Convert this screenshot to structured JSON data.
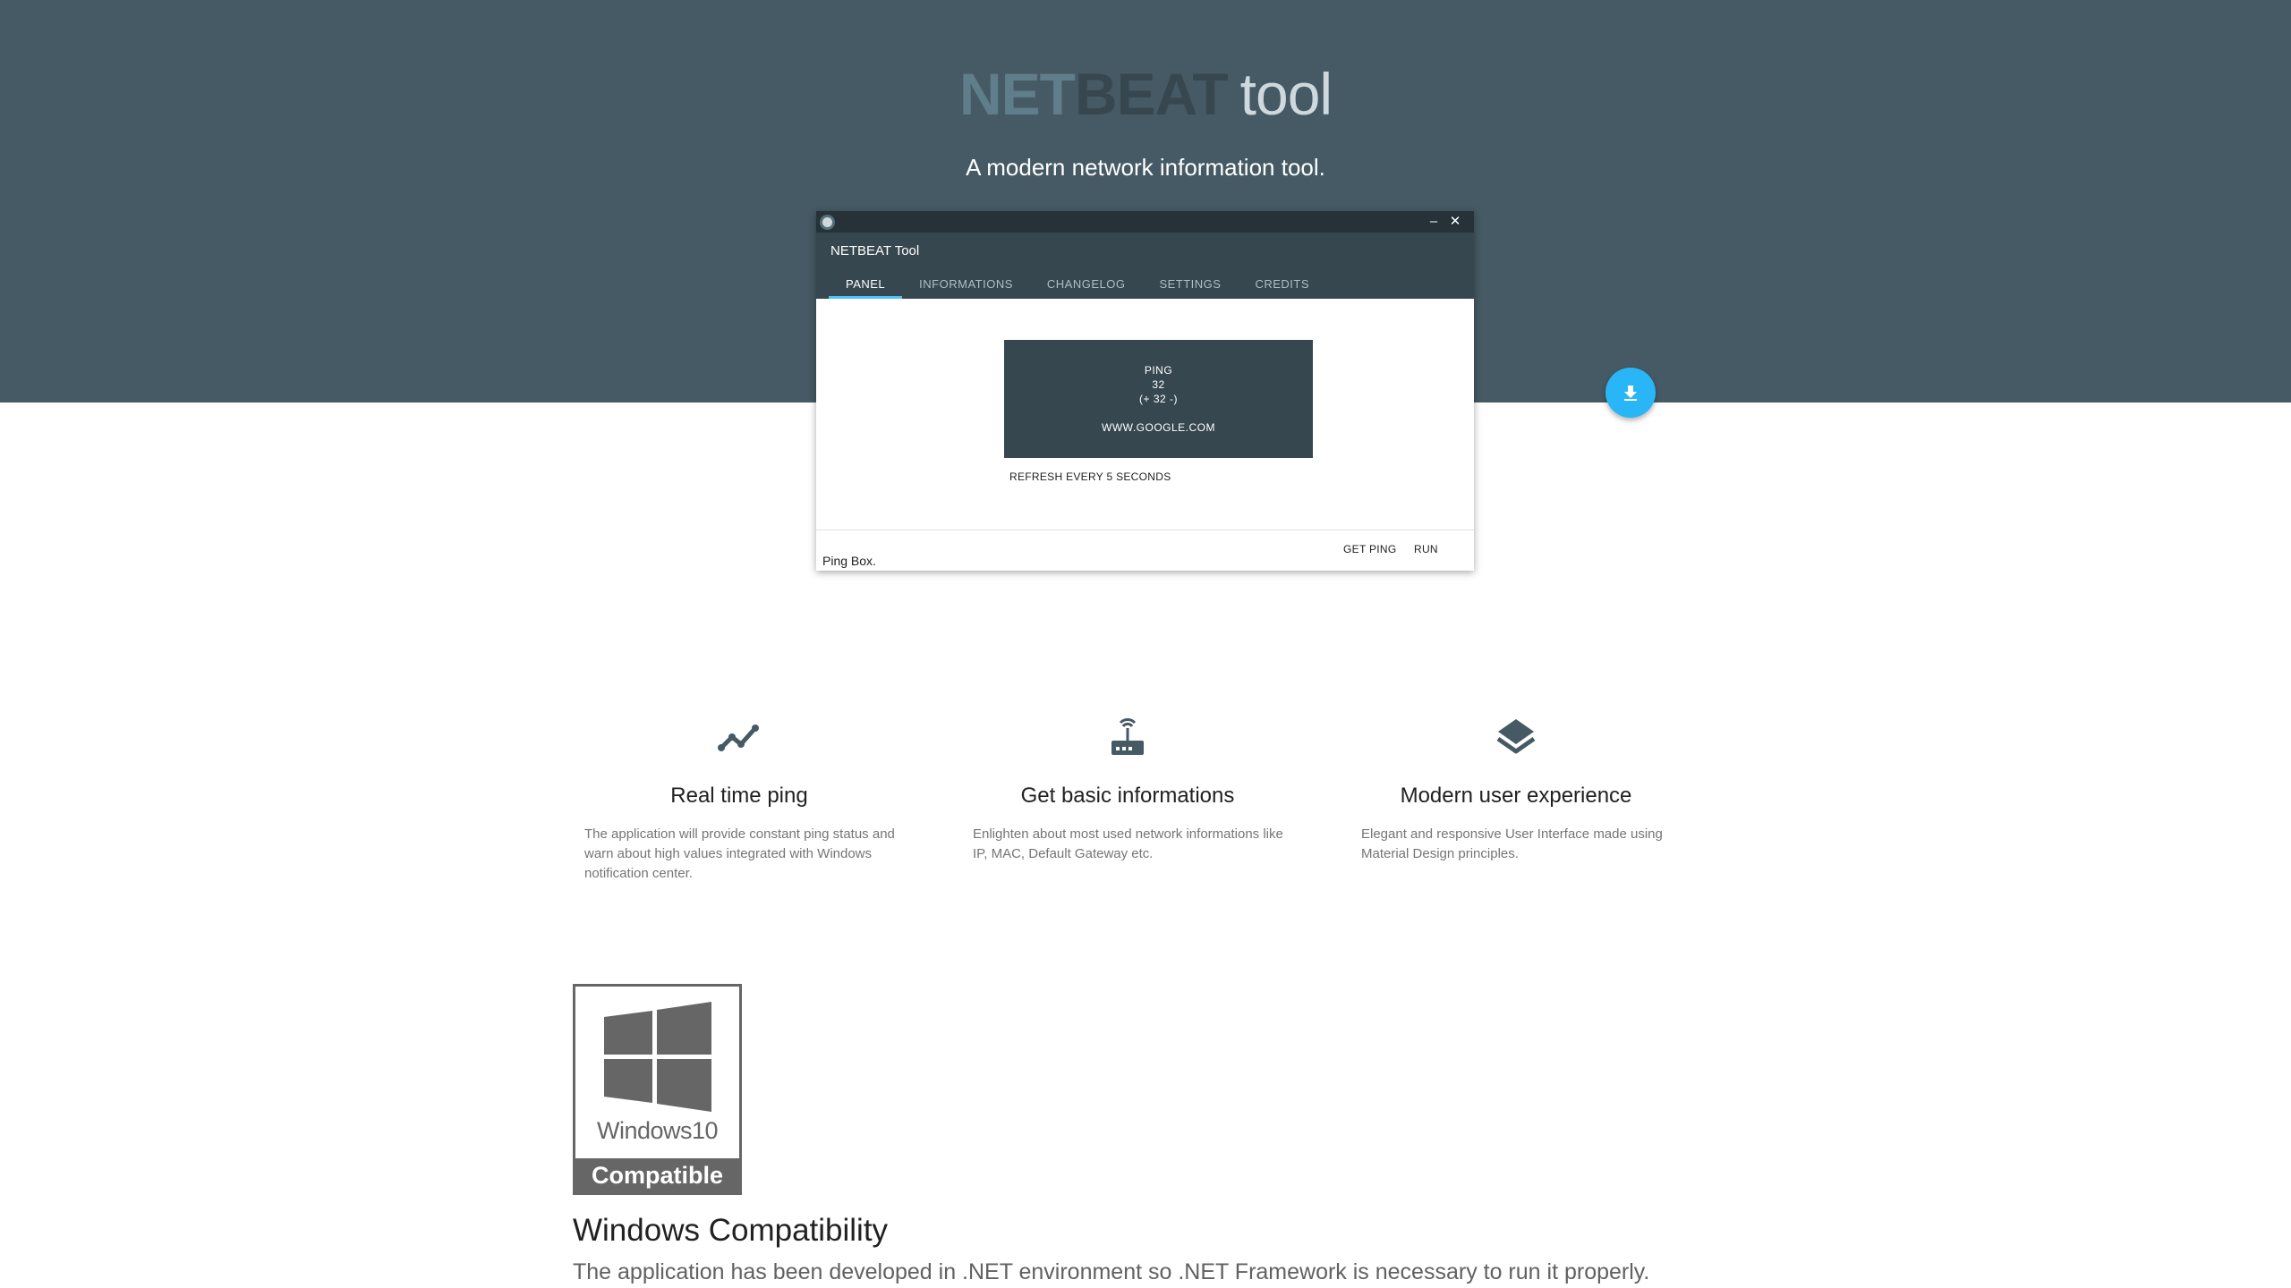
{
  "hero": {
    "logo_net": "NET",
    "logo_beat": "BEAT",
    "logo_tool": "tool",
    "tagline": "A modern network information tool."
  },
  "app_window": {
    "minimize_glyph": "–",
    "close_glyph": "✕",
    "title": "NETBEAT Tool",
    "tabs": [
      {
        "label": "PANEL",
        "active": true
      },
      {
        "label": "INFORMATIONS",
        "active": false
      },
      {
        "label": "CHANGELOG",
        "active": false
      },
      {
        "label": "SETTINGS",
        "active": false
      },
      {
        "label": "CREDITS",
        "active": false
      }
    ],
    "ping_box": {
      "label": "PING",
      "value": "32",
      "delta": "(+ 32 -)",
      "host": "WWW.GOOGLE.COM"
    },
    "refresh_text": "REFRESH EVERY 5 SECONDS",
    "footer_label": "Ping Box.",
    "buttons": {
      "get_ping": "GET PING",
      "run": "RUN"
    }
  },
  "fab": {
    "icon": "download-icon",
    "color": "#29b6f6"
  },
  "features": [
    {
      "icon": "trending-line-icon",
      "title": "Real time ping",
      "description": "The application will provide constant ping status and warn about high values integrated with Windows notification center."
    },
    {
      "icon": "router-icon",
      "title": "Get basic informations",
      "description": "Enlighten about most used network informations like IP, MAC, Default Gateway etc."
    },
    {
      "icon": "layers-icon",
      "title": "Modern user experience",
      "description": "Elegant and responsive User Interface made using Material Design principles."
    }
  ],
  "windows_badge": {
    "line1": "Windows10",
    "line2": "Compatible"
  },
  "compatibility": {
    "title": "Windows Compatibility",
    "description": "The application has been developed in .NET environment so .NET Framework is necessary to run it properly."
  },
  "colors": {
    "hero_bg": "#455a64",
    "appbar": "#37474f",
    "accent": "#4fc3f7"
  }
}
